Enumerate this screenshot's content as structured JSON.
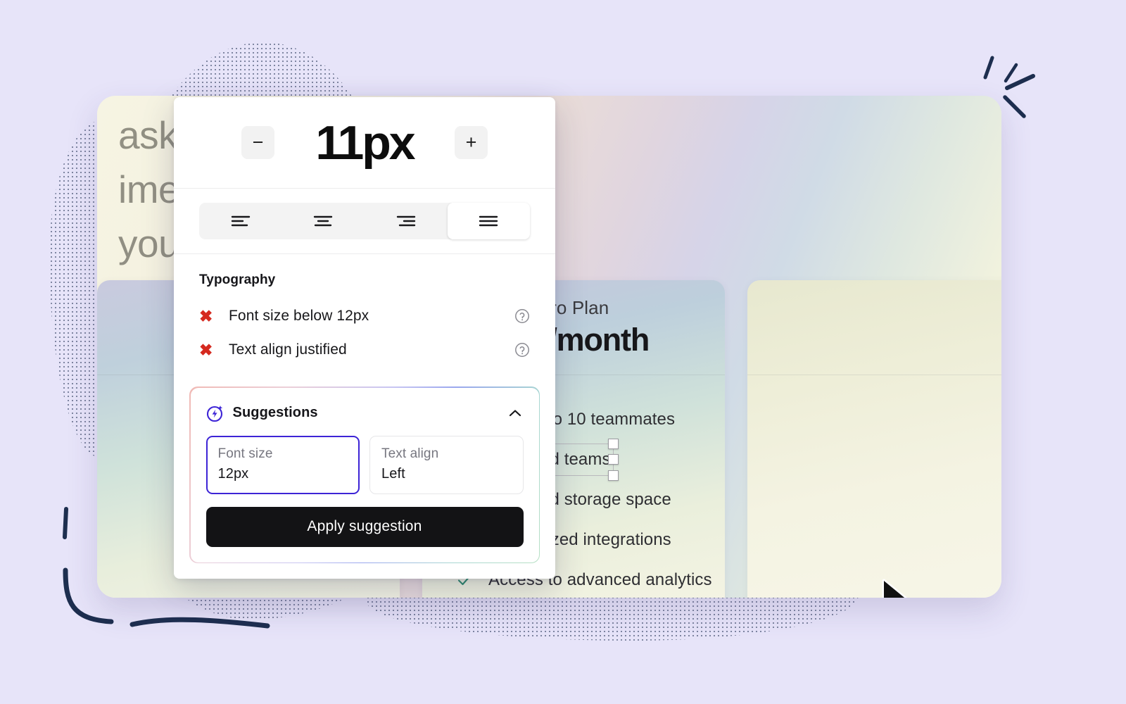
{
  "background": {
    "page_color": "#e7e4f9",
    "decorations": [
      "halftone-dot-blob",
      "ink-burst-lines",
      "ink-corner-bracket"
    ]
  },
  "canvas": {
    "hero_text": "ask a     nd real\nime n       erything\nyou ne      work.",
    "pricing_cards": [
      {
        "plan": "",
        "price": "",
        "features": []
      },
      {
        "plan": "Pro Plan",
        "price": "$20/month",
        "features": [
          {
            "label": "Limited to 10 teammates",
            "icon": "check-icon",
            "selected": false
          },
          {
            "label": "Unlimited teams",
            "icon": "check-icon",
            "selected": true
          },
          {
            "label": "Unlimited storage space",
            "icon": "check-icon",
            "selected": false
          },
          {
            "label": "Customized integrations",
            "icon": "check-icon",
            "selected": false
          },
          {
            "label": "Access to advanced analytics",
            "icon": "check-icon",
            "selected": false
          }
        ]
      },
      {
        "plan": "",
        "price": "",
        "features": []
      }
    ],
    "cursor_icon": "mouse-pointer-icon"
  },
  "panel": {
    "font_size": {
      "decrease_label": "−",
      "value": "11px",
      "increase_label": "+",
      "decrease_icon": "minus-icon",
      "increase_icon": "plus-icon"
    },
    "alignment": {
      "options": [
        {
          "name": "align-left",
          "icon": "align-left-icon",
          "active": false
        },
        {
          "name": "align-center",
          "icon": "align-center-icon",
          "active": false
        },
        {
          "name": "align-right",
          "icon": "align-right-icon",
          "active": false
        },
        {
          "name": "align-justify",
          "icon": "align-justify-icon",
          "active": true
        }
      ]
    },
    "typography": {
      "title": "Typography",
      "issues": [
        {
          "label": "Font size below 12px",
          "status_icon": "error-x-icon",
          "help_icon": "help-circle-icon"
        },
        {
          "label": "Text align justified",
          "status_icon": "error-x-icon",
          "help_icon": "help-circle-icon"
        }
      ]
    },
    "suggestions": {
      "title": "Suggestions",
      "header_icon": "sparkle-bolt-icon",
      "collapse_icon": "chevron-up-icon",
      "cards": [
        {
          "label": "Font size",
          "value": "12px",
          "selected": true
        },
        {
          "label": "Text align",
          "value": "Left",
          "selected": false
        }
      ],
      "apply_label": "Apply suggestion"
    }
  },
  "colors": {
    "accent_purple": "#3d24d6",
    "error_red": "#d5291f",
    "check_green": "#2f8a6e",
    "button_black": "#131315",
    "panel_white": "#ffffff",
    "ink_navy": "#1d2e4f"
  }
}
